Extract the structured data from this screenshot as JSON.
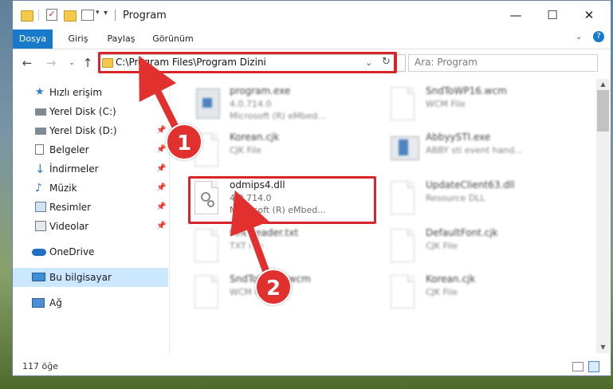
{
  "window": {
    "title": "Program",
    "controls": {
      "minimize": "—",
      "maximize": "☐",
      "close": "✕"
    }
  },
  "ribbon": {
    "tabs": [
      "Dosya",
      "Giriş",
      "Paylaş",
      "Görünüm"
    ],
    "file_tab_color": "#1979ca"
  },
  "address_bar": {
    "path": "C:\\Program Files\\Program Dizini",
    "highlight_color": "#d6262a"
  },
  "search": {
    "placeholder": "Ara: Program"
  },
  "nav_pane": {
    "quick_access": "Hızlı erişim",
    "items": [
      {
        "label": "Yerel Disk (C:)",
        "icon": "drive-icon"
      },
      {
        "label": "Yerel Disk (D:)",
        "icon": "drive-icon"
      },
      {
        "label": "Belgeler",
        "icon": "documents-icon"
      },
      {
        "label": "İndirmeler",
        "icon": "download-icon"
      },
      {
        "label": "Müzik",
        "icon": "music-icon"
      },
      {
        "label": "Resimler",
        "icon": "pictures-icon"
      },
      {
        "label": "Videolar",
        "icon": "videos-icon"
      }
    ],
    "onedrive": "OneDrive",
    "this_pc": "Bu bilgisayar",
    "network": "Ağ"
  },
  "files": [
    {
      "name": "program.exe",
      "line2": "4.0.714.0",
      "line3": "Microsoft (R) eMbed...",
      "icon": "exe-icon"
    },
    {
      "name": "SndToWP16.wcm",
      "line2": "WCM File",
      "line3": "",
      "icon": "file-icon"
    },
    {
      "name": "Korean.cjk",
      "line2": "CJK File",
      "line3": "",
      "icon": "file-icon"
    },
    {
      "name": "AbbyySTI.exe",
      "line2": "ABBY sti event hand...",
      "line3": "",
      "icon": "exe-icon"
    },
    {
      "name": "odmips4.dll",
      "line2": "4.0.714.0",
      "line3": "Microsoft (R) eMbed...",
      "icon": "dll-icon"
    },
    {
      "name": "UpdateClient63.dll",
      "line2": "Resource DLL",
      "line3": "",
      "icon": "dll-icon"
    },
    {
      "name": "FineReader.txt",
      "line2": "TXT File",
      "line3": "",
      "icon": "file-icon"
    },
    {
      "name": "DefaultFont.cjk",
      "line2": "CJK File",
      "line3": "",
      "icon": "file-icon"
    },
    {
      "name": "SndToWP16.wcm",
      "line2": "WCM File",
      "line3": "",
      "icon": "file-icon"
    },
    {
      "name": "Korean.cjk",
      "line2": "CJK File",
      "line3": "",
      "icon": "file-icon"
    }
  ],
  "status_bar": {
    "item_count": "117 öğe"
  },
  "annotations": {
    "marker1": "1",
    "marker2": "2",
    "marker_color": "#e2302f"
  }
}
